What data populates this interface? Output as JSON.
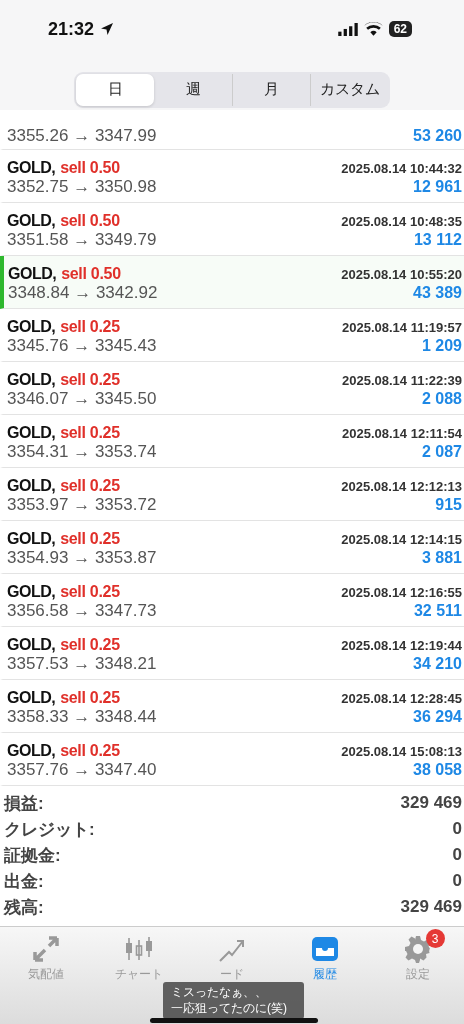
{
  "status_bar": {
    "time": "21:32",
    "battery": "62"
  },
  "segments": [
    {
      "label": "日",
      "selected": true
    },
    {
      "label": "週",
      "selected": false
    },
    {
      "label": "月",
      "selected": false
    },
    {
      "label": "カスタム",
      "selected": false
    }
  ],
  "trades": [
    {
      "prices": "3355.26 → 3347.99",
      "profit": "53 260",
      "selected": false
    },
    {
      "symbol": "GOLD,",
      "side": "sell 0.50",
      "time": "2025.08.14 10:44:32",
      "prices": "3352.75 → 3350.98",
      "profit": "12 961",
      "selected": false
    },
    {
      "symbol": "GOLD,",
      "side": "sell 0.50",
      "time": "2025.08.14 10:48:35",
      "prices": "3351.58 → 3349.79",
      "profit": "13 112",
      "selected": false
    },
    {
      "symbol": "GOLD,",
      "side": "sell 0.50",
      "time": "2025.08.14 10:55:20",
      "prices": "3348.84 → 3342.92",
      "profit": "43 389",
      "selected": true
    },
    {
      "symbol": "GOLD,",
      "side": "sell 0.25",
      "time": "2025.08.14 11:19:57",
      "prices": "3345.76 → 3345.43",
      "profit": "1 209",
      "selected": false
    },
    {
      "symbol": "GOLD,",
      "side": "sell 0.25",
      "time": "2025.08.14 11:22:39",
      "prices": "3346.07 → 3345.50",
      "profit": "2 088",
      "selected": false
    },
    {
      "symbol": "GOLD,",
      "side": "sell 0.25",
      "time": "2025.08.14 12:11:54",
      "prices": "3354.31 → 3353.74",
      "profit": "2 087",
      "selected": false
    },
    {
      "symbol": "GOLD,",
      "side": "sell 0.25",
      "time": "2025.08.14 12:12:13",
      "prices": "3353.97 → 3353.72",
      "profit": "915",
      "selected": false
    },
    {
      "symbol": "GOLD,",
      "side": "sell 0.25",
      "time": "2025.08.14 12:14:15",
      "prices": "3354.93 → 3353.87",
      "profit": "3 881",
      "selected": false
    },
    {
      "symbol": "GOLD,",
      "side": "sell 0.25",
      "time": "2025.08.14 12:16:55",
      "prices": "3356.58 → 3347.73",
      "profit": "32 511",
      "selected": false
    },
    {
      "symbol": "GOLD,",
      "side": "sell 0.25",
      "time": "2025.08.14 12:19:44",
      "prices": "3357.53 → 3348.21",
      "profit": "34 210",
      "selected": false
    },
    {
      "symbol": "GOLD,",
      "side": "sell 0.25",
      "time": "2025.08.14 12:28:45",
      "prices": "3358.33 → 3348.44",
      "profit": "36 294",
      "selected": false
    },
    {
      "symbol": "GOLD,",
      "side": "sell 0.25",
      "time": "2025.08.14 15:08:13",
      "prices": "3357.76 → 3347.40",
      "profit": "38 058",
      "selected": false
    }
  ],
  "summary": [
    {
      "label": "損益:",
      "value": "329 469"
    },
    {
      "label": "クレジット:",
      "value": "0"
    },
    {
      "label": "証拠金:",
      "value": "0"
    },
    {
      "label": "出金:",
      "value": "0"
    },
    {
      "label": "残高:",
      "value": "329 469"
    }
  ],
  "tab_bar": [
    {
      "label": "気配値",
      "kind": "quotes",
      "selected": false
    },
    {
      "label": "チャート",
      "kind": "chart",
      "selected": false
    },
    {
      "label": "ード",
      "kind": "trade",
      "selected": false
    },
    {
      "label": "履歴",
      "kind": "history",
      "selected": true
    },
    {
      "label": "設定",
      "kind": "settings",
      "selected": false,
      "badge": "3"
    }
  ],
  "caption": [
    "ミスったなぁ、、",
    "一応狙ってたのに(笑)"
  ]
}
